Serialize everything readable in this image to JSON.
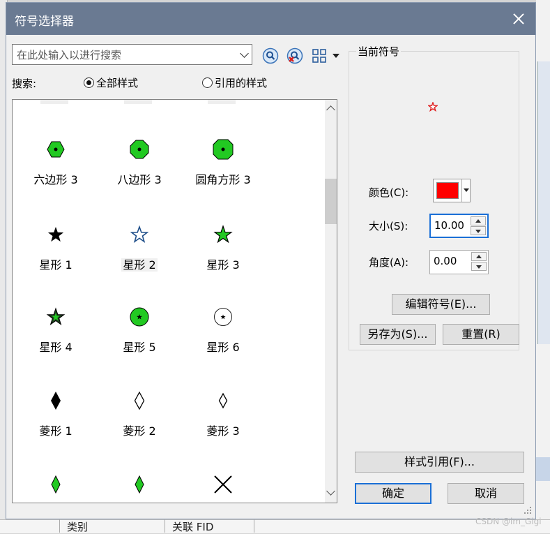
{
  "dialog": {
    "title": "符号选择器",
    "search_placeholder": "在此处输入以进行搜索",
    "search_label": "搜索:",
    "radio_all": "全部样式",
    "radio_referenced": "引用的样式"
  },
  "symbols": [
    {
      "label": "六边形 3",
      "icon": "hexagon-green"
    },
    {
      "label": "八边形 3",
      "icon": "octagon-green"
    },
    {
      "label": "圆角方形 3",
      "icon": "rounded-square-green"
    },
    {
      "label": "星形 1",
      "icon": "star-black"
    },
    {
      "label": "星形 2",
      "icon": "star-outline-blue",
      "selected": true
    },
    {
      "label": "星形 3",
      "icon": "star-green-outline"
    },
    {
      "label": "星形 4",
      "icon": "star-green-dark"
    },
    {
      "label": "星形 5",
      "icon": "circle-green-star"
    },
    {
      "label": "星形 6",
      "icon": "circle-white-star"
    },
    {
      "label": "菱形 1",
      "icon": "diamond-black"
    },
    {
      "label": "菱形 2",
      "icon": "diamond-outline"
    },
    {
      "label": "菱形 3",
      "icon": "diamond-outline-small"
    },
    {
      "label": "",
      "icon": "diamond-green"
    },
    {
      "label": "",
      "icon": "diamond-green"
    },
    {
      "label": "",
      "icon": "cross-x"
    }
  ],
  "current": {
    "group_title": "当前符号",
    "color_label": "颜色(C):",
    "color_value": "#ff0000",
    "size_label": "大小(S):",
    "size_value": "10.00",
    "angle_label": "角度(A):",
    "angle_value": "0.00",
    "edit_button": "编辑符号(E)...",
    "save_as_button": "另存为(S)...",
    "reset_button": "重置(R)"
  },
  "footer": {
    "style_ref_button": "样式引用(F)...",
    "ok_button": "确定",
    "cancel_button": "取消"
  },
  "background": {
    "col1": "类别",
    "col2": "关联 FID"
  },
  "watermark": "CSDN @im_Gigi"
}
